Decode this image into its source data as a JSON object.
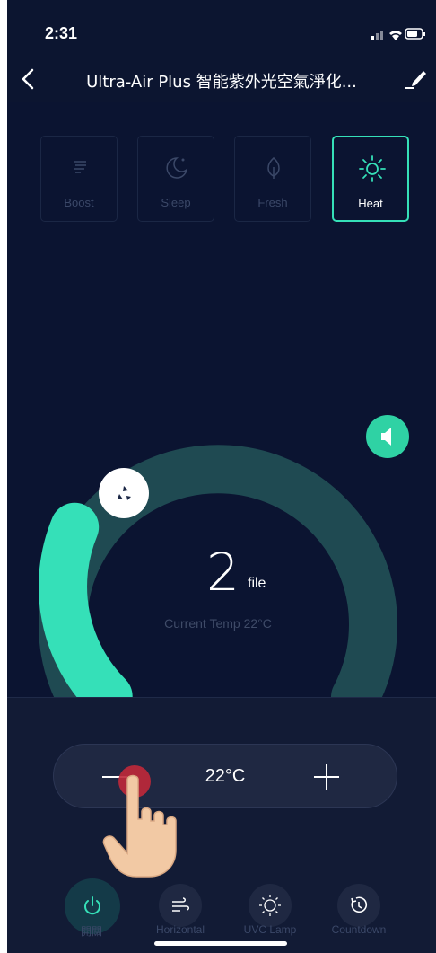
{
  "status_bar": {
    "time": "2:31"
  },
  "header": {
    "title": "Ultra-Air Plus 智能紫外光空氣淨化..."
  },
  "modes": [
    {
      "label": "Boost",
      "icon": "fan-lines-icon",
      "active": false
    },
    {
      "label": "Sleep",
      "icon": "moon-icon",
      "active": false
    },
    {
      "label": "Fresh",
      "icon": "leaf-icon",
      "active": false
    },
    {
      "label": "Heat",
      "icon": "sun-icon",
      "active": true
    }
  ],
  "dial": {
    "value": "2",
    "unit": "file",
    "current_temp": "Current Temp 22°C",
    "level_fraction": 0.25
  },
  "temp_control": {
    "value": "22°C"
  },
  "bottom_buttons": [
    {
      "label": "開關",
      "icon": "power-icon"
    },
    {
      "label": "Horizontal",
      "icon": "wind-icon"
    },
    {
      "label": "UVC Lamp",
      "icon": "uv-lamp-icon"
    },
    {
      "label": "Countdown",
      "icon": "timer-icon"
    }
  ],
  "colors": {
    "background": "#0c1530",
    "accent": "#35e0b8",
    "track": "#1f4a52"
  }
}
